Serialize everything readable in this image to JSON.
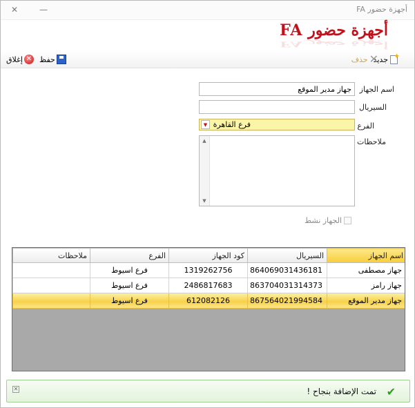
{
  "window": {
    "title": "أجهزة حضور FA",
    "minimize_glyph": "—",
    "close_glyph": "✕"
  },
  "heading": "أجهزة حضور FA",
  "toolbar": {
    "new_label": "جديد",
    "delete_label": "حذف",
    "save_label": "حفظ",
    "close_label": "إغلاق",
    "close_glyph": "✕",
    "delete_glyph": "✕"
  },
  "form": {
    "device_name_label": "اسم الجهاز",
    "device_name_value": "جهاز مدير الموقع",
    "serial_label": "السيريال",
    "serial_value": "",
    "branch_label": "الفرع",
    "branch_value": "فرع القاهرة",
    "branch_arrow_glyph": "▼",
    "notes_label": "ملاحظات",
    "notes_value": "",
    "scroll_up_glyph": "▲",
    "scroll_down_glyph": "▼",
    "active_label": "الجهاز نشط",
    "active_checked": false
  },
  "grid": {
    "columns": [
      "اسم الجهاز",
      "السيريال",
      "كود الجهاز",
      "الفرع",
      "ملاحظات"
    ],
    "rows": [
      {
        "name": "جهاز مصطفى",
        "serial": "864069031436181",
        "code": "1319262756",
        "branch": "فرع اسيوط",
        "notes": ""
      },
      {
        "name": "جهاز رامز",
        "serial": "863704031314373",
        "code": "2486817683",
        "branch": "فرع اسيوط",
        "notes": ""
      },
      {
        "name": "جهاز مدير الموقع",
        "serial": "867564021994584",
        "code": "612082126",
        "branch": "فرع اسيوط",
        "notes": ""
      }
    ],
    "selected_index": 2
  },
  "status": {
    "message": "تمت الإضافة بنجاح !",
    "check_glyph": "✔",
    "close_glyph": "✕"
  },
  "colors": {
    "heading": "#c1121c",
    "selection": "#f7d24a",
    "status_bg": "#e3f3dc",
    "grid_empty": "#a9a9a9"
  },
  "icons": {
    "new": "new-document-icon",
    "delete": "delete-icon",
    "save": "save-disk-icon",
    "close": "close-red-icon",
    "status": "checkmark-icon"
  }
}
